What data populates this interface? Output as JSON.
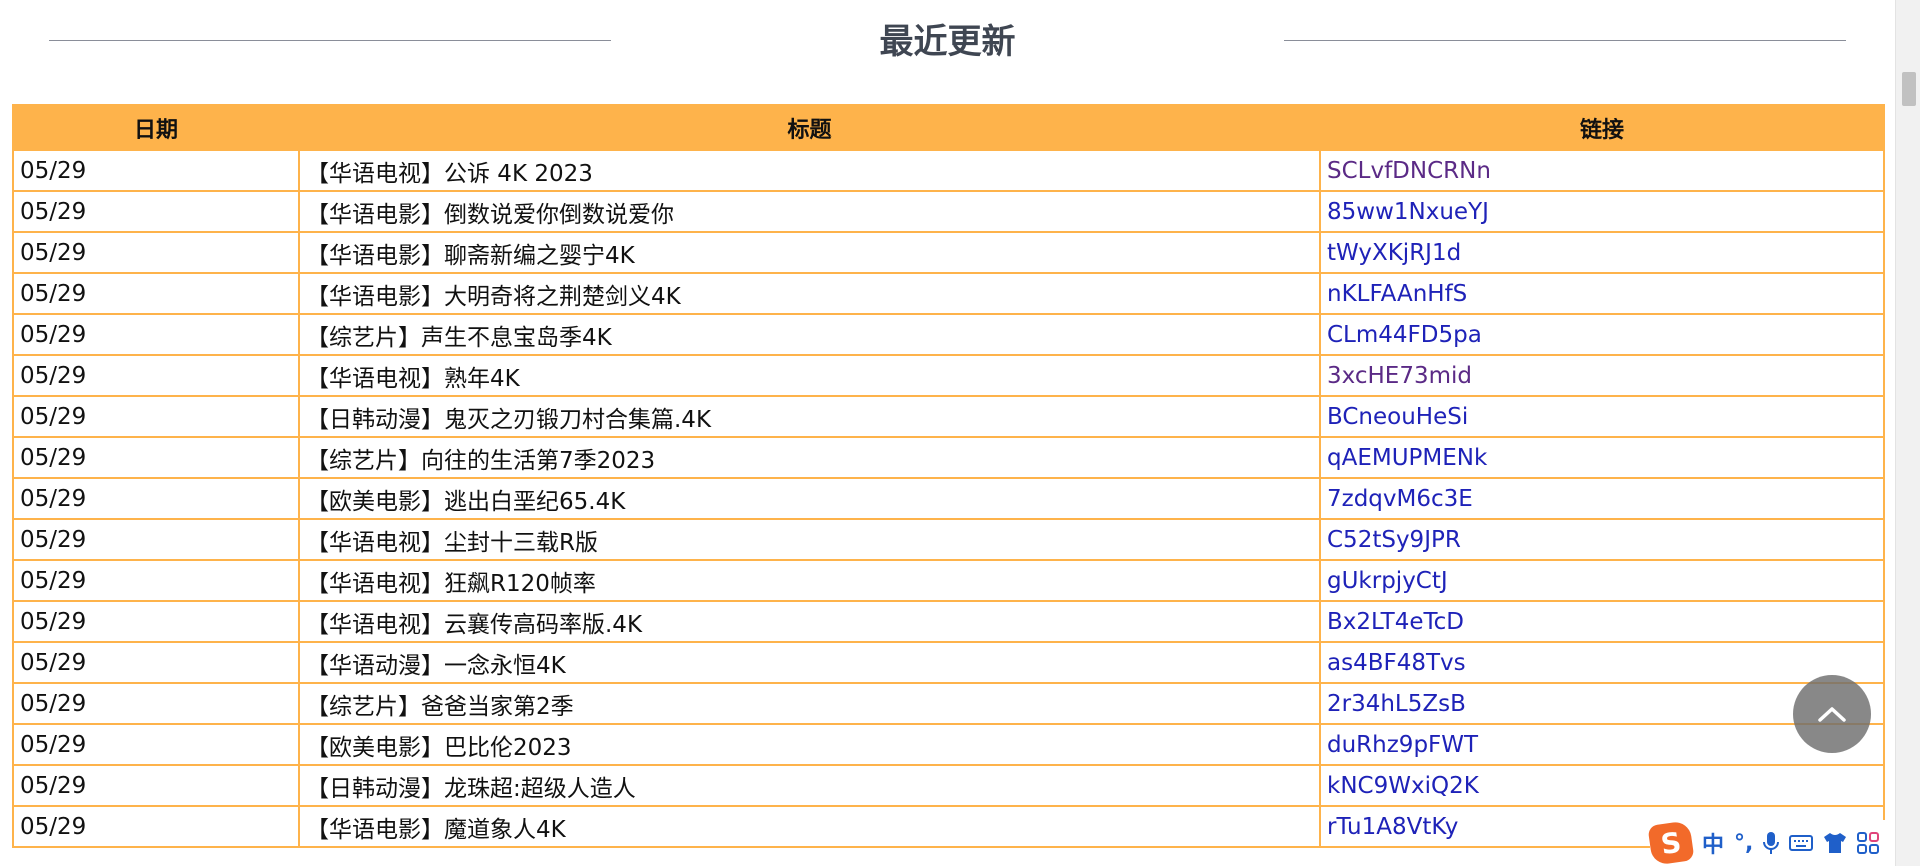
{
  "header": {
    "title": "最近更新"
  },
  "table": {
    "columns": [
      "日期",
      "标题",
      "链接"
    ],
    "rows": [
      {
        "date": "05/29",
        "title": "【华语电视】公诉 4K 2023",
        "link": "SCLvfDNCRNn",
        "visited": true
      },
      {
        "date": "05/29",
        "title": "【华语电影】倒数说爱你倒数说爱你",
        "link": "85ww1NxueYJ",
        "visited": false
      },
      {
        "date": "05/29",
        "title": "【华语电影】聊斋新编之婴宁4K",
        "link": "tWyXKjRJ1d",
        "visited": false
      },
      {
        "date": "05/29",
        "title": "【华语电影】大明奇将之荆楚剑义4K",
        "link": "nKLFAAnHfS",
        "visited": false
      },
      {
        "date": "05/29",
        "title": "【综艺片】声生不息宝岛季4K",
        "link": "CLm44FD5pa",
        "visited": false
      },
      {
        "date": "05/29",
        "title": "【华语电视】熟年4K",
        "link": "3xcHE73mid",
        "visited": true
      },
      {
        "date": "05/29",
        "title": "【日韩动漫】鬼灭之刃锻刀村合集篇.4K",
        "link": "BCneouHeSi",
        "visited": false
      },
      {
        "date": "05/29",
        "title": "【综艺片】向往的生活第7季2023",
        "link": "qAEMUPMENk",
        "visited": false
      },
      {
        "date": "05/29",
        "title": "【欧美电影】逃出白垩纪65.4K",
        "link": "7zdqvM6c3E",
        "visited": false
      },
      {
        "date": "05/29",
        "title": "【华语电视】尘封十三载R版",
        "link": "C52tSy9JPR",
        "visited": false
      },
      {
        "date": "05/29",
        "title": "【华语电视】狂飙R120帧率",
        "link": "gUkrpjyCtJ",
        "visited": false
      },
      {
        "date": "05/29",
        "title": "【华语电视】云襄传高码率版.4K",
        "link": "Bx2LT4eTcD",
        "visited": false
      },
      {
        "date": "05/29",
        "title": "【华语动漫】一念永恒4K",
        "link": "as4BF48Tvs",
        "visited": false
      },
      {
        "date": "05/29",
        "title": "【综艺片】爸爸当家第2季",
        "link": "2r34hL5ZsB",
        "visited": false
      },
      {
        "date": "05/29",
        "title": "【欧美电影】巴比伦2023",
        "link": "duRhz9pFWT",
        "visited": false
      },
      {
        "date": "05/29",
        "title": "【日韩动漫】龙珠超:超级人造人",
        "link": "kNC9WxiQ2K",
        "visited": false
      },
      {
        "date": "05/29",
        "title": "【华语电影】魔道象人4K",
        "link": "rTu1A8VtKy",
        "visited": false
      }
    ]
  },
  "ime": {
    "logo": "S",
    "mode": "中",
    "punct": "°,"
  },
  "colors": {
    "header_bg": "#feb34b",
    "border": "#feb34b",
    "link": "#1e22b8",
    "visited_link": "#5b2a86",
    "title_text": "#3f4652"
  },
  "icons": [
    "chevron-up-icon",
    "microphone-icon",
    "keyboard-icon",
    "shirt-icon",
    "grid-icon"
  ]
}
